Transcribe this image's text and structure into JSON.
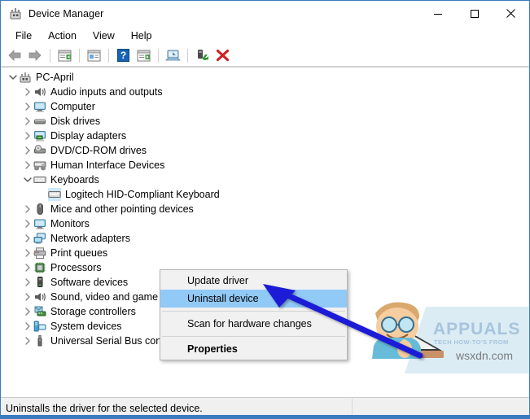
{
  "window": {
    "title": "Device Manager",
    "icon": "device-manager-icon",
    "controls": {
      "minimize": "—",
      "maximize": "□",
      "close": "✕"
    }
  },
  "menubar": {
    "items": [
      {
        "label": "File"
      },
      {
        "label": "Action"
      },
      {
        "label": "View"
      },
      {
        "label": "Help"
      }
    ]
  },
  "toolbar": {
    "buttons": [
      {
        "name": "back-icon",
        "tooltip": "Back"
      },
      {
        "name": "forward-icon",
        "tooltip": "Forward"
      },
      {
        "name": "separator-1"
      },
      {
        "name": "show-hide-console-tree-icon",
        "tooltip": "Show/Hide Console Tree"
      },
      {
        "name": "separator-2"
      },
      {
        "name": "properties-icon",
        "tooltip": "Properties"
      },
      {
        "name": "separator-3"
      },
      {
        "name": "help-icon",
        "tooltip": "Help"
      },
      {
        "name": "show-hide-action-pane-icon",
        "tooltip": "Show/Hide Action Pane"
      },
      {
        "name": "separator-4"
      },
      {
        "name": "scan-for-hardware-changes-icon",
        "tooltip": "Scan for hardware changes"
      },
      {
        "name": "separator-5"
      },
      {
        "name": "update-driver-icon",
        "tooltip": "Update Driver Software"
      },
      {
        "name": "uninstall-device-icon",
        "tooltip": "Uninstall device"
      }
    ]
  },
  "tree": {
    "root": {
      "label": "PC-April",
      "icon": "computer-root-icon",
      "expanded": true,
      "indent": 0
    },
    "items": [
      {
        "label": "Audio inputs and outputs",
        "icon": "speaker-icon",
        "expanded": false,
        "indent": 1,
        "selected": false
      },
      {
        "label": "Computer",
        "icon": "monitor-icon",
        "expanded": false,
        "indent": 1,
        "selected": false
      },
      {
        "label": "Disk drives",
        "icon": "disk-drive-icon",
        "expanded": false,
        "indent": 1,
        "selected": false
      },
      {
        "label": "Display adapters",
        "icon": "display-adapter-icon",
        "expanded": false,
        "indent": 1,
        "selected": false
      },
      {
        "label": "DVD/CD-ROM drives",
        "icon": "optical-drive-icon",
        "expanded": false,
        "indent": 1,
        "selected": false
      },
      {
        "label": "Human Interface Devices",
        "icon": "hid-icon",
        "expanded": false,
        "indent": 1,
        "selected": false
      },
      {
        "label": "Keyboards",
        "icon": "keyboard-icon",
        "expanded": true,
        "indent": 1,
        "selected": false
      },
      {
        "label": "Logitech HID-Compliant Keyboard",
        "icon": "keyboard-device-icon",
        "expanded": null,
        "indent": 2,
        "selected": true
      },
      {
        "label": "Mice and other pointing devices",
        "icon": "mouse-icon",
        "expanded": false,
        "indent": 1,
        "selected": false
      },
      {
        "label": "Monitors",
        "icon": "monitor-icon",
        "expanded": false,
        "indent": 1,
        "selected": false
      },
      {
        "label": "Network adapters",
        "icon": "network-adapter-icon",
        "expanded": false,
        "indent": 1,
        "selected": false
      },
      {
        "label": "Print queues",
        "icon": "printer-icon",
        "expanded": false,
        "indent": 1,
        "selected": false
      },
      {
        "label": "Processors",
        "icon": "processor-icon",
        "expanded": false,
        "indent": 1,
        "selected": false
      },
      {
        "label": "Software devices",
        "icon": "software-device-icon",
        "expanded": false,
        "indent": 1,
        "selected": false
      },
      {
        "label": "Sound, video and game controllers",
        "icon": "speaker-icon",
        "expanded": false,
        "indent": 1,
        "selected": false
      },
      {
        "label": "Storage controllers",
        "icon": "storage-controller-icon",
        "expanded": false,
        "indent": 1,
        "selected": false
      },
      {
        "label": "System devices",
        "icon": "system-device-icon",
        "expanded": false,
        "indent": 1,
        "selected": false
      },
      {
        "label": "Universal Serial Bus controllers",
        "icon": "usb-icon",
        "expanded": false,
        "indent": 1,
        "selected": false
      }
    ]
  },
  "context_menu": {
    "items": [
      {
        "label": "Update driver",
        "highlighted": false,
        "bold": false
      },
      {
        "label": "Uninstall device",
        "highlighted": true,
        "bold": false
      },
      {
        "separator": true
      },
      {
        "label": "Scan for hardware changes",
        "highlighted": false,
        "bold": false
      },
      {
        "separator": true
      },
      {
        "label": "Properties",
        "highlighted": false,
        "bold": true
      }
    ]
  },
  "annotation": {
    "arrow_color": "#1a1ad6",
    "points_to": "Uninstall device"
  },
  "watermark": {
    "brand": "APPUALS",
    "tagline": "TECH HOW-TO'S FROM",
    "domain": "wsxdn.com",
    "brand_color": "#a8c4dd"
  },
  "statusbar": {
    "message": "Uninstalls the driver for the selected device."
  }
}
